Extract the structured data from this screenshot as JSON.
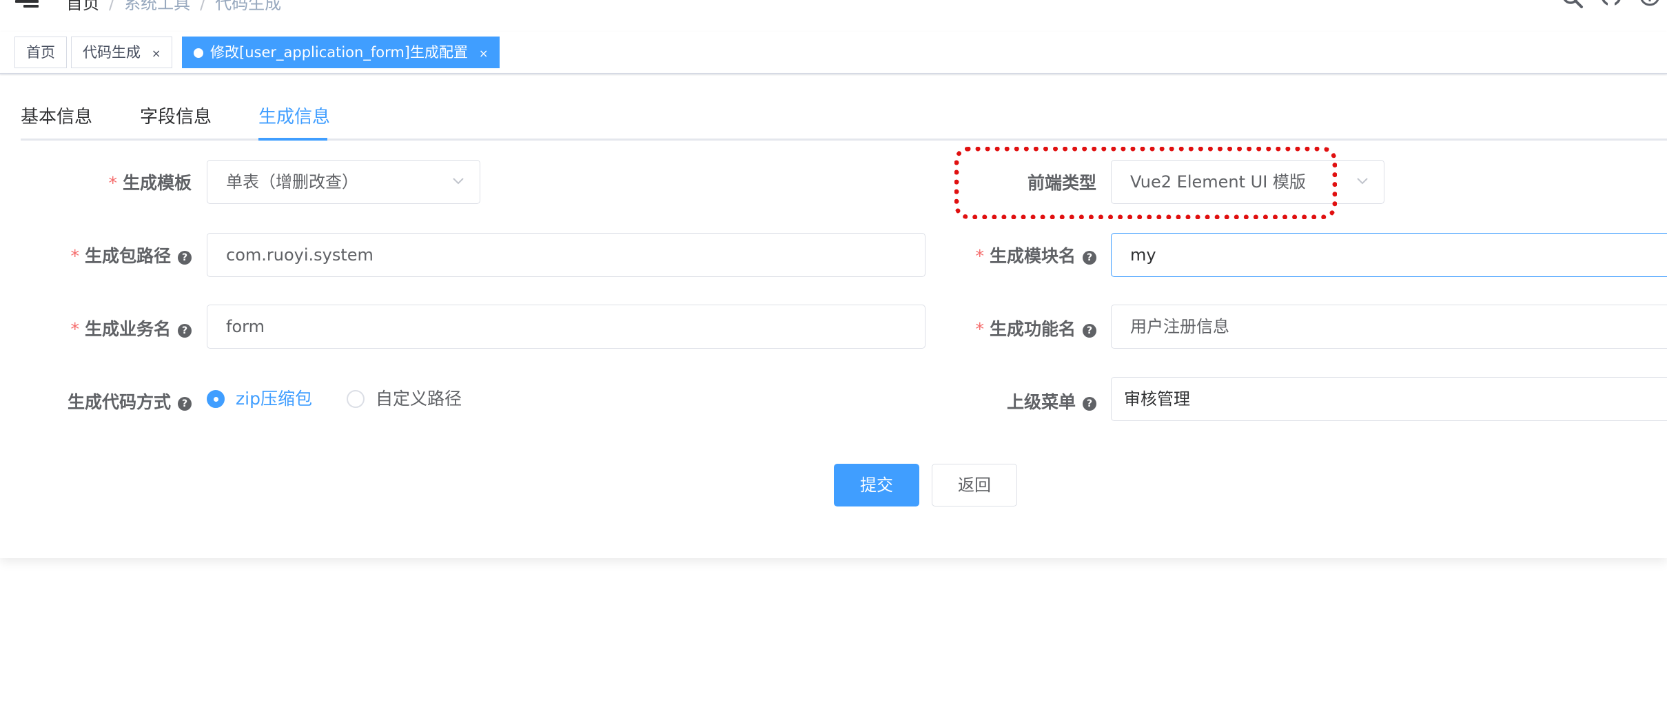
{
  "navbar": {
    "breadcrumb": [
      {
        "label": "首页"
      },
      {
        "label": "系统工具"
      },
      {
        "label": "代码生成"
      }
    ],
    "separator": "/",
    "icons": [
      "search-icon",
      "github-icon",
      "question-icon"
    ]
  },
  "tags_view": {
    "tags": [
      {
        "label": "首页",
        "closable": false,
        "active": false
      },
      {
        "label": "代码生成",
        "close": "×",
        "active": false
      },
      {
        "label": "修改[user_application_form]生成配置",
        "close": "×",
        "active": true
      }
    ]
  },
  "tabs": [
    {
      "label": "基本信息",
      "active": false
    },
    {
      "label": "字段信息",
      "active": false
    },
    {
      "label": "生成信息",
      "active": true
    }
  ],
  "form": {
    "required_mark": "*",
    "help_mark": "?",
    "template": {
      "label": "生成模板",
      "value": "单表（增删改查）"
    },
    "frontend_type": {
      "label": "前端类型",
      "value": "Vue2 Element UI 模版"
    },
    "package_path": {
      "label": "生成包路径",
      "value": "com.ruoyi.system"
    },
    "module_name": {
      "label": "生成模块名",
      "value": "my"
    },
    "business_name": {
      "label": "生成业务名",
      "value": "form"
    },
    "function_name": {
      "label": "生成功能名",
      "value": "用户注册信息"
    },
    "gen_type": {
      "label": "生成代码方式",
      "options": [
        {
          "label": "zip压缩包",
          "checked": true
        },
        {
          "label": "自定义路径",
          "checked": false
        }
      ]
    },
    "parent_menu": {
      "label": "上级菜单",
      "value": "审核管理"
    }
  },
  "buttons": {
    "submit": "提交",
    "back": "返回"
  },
  "colors": {
    "primary": "#409eff",
    "required": "#f56c6c",
    "annotation": "#e01010"
  }
}
